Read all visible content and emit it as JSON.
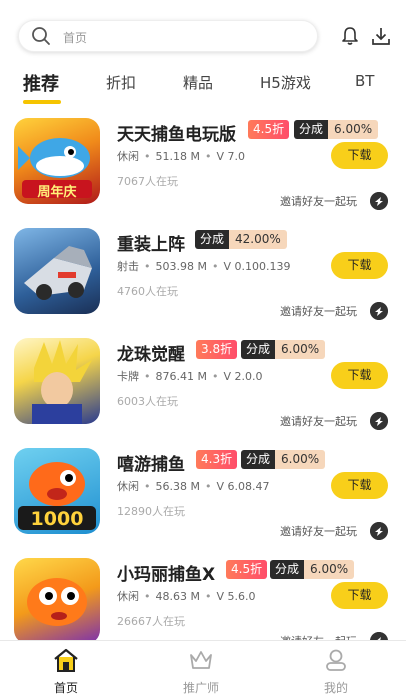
{
  "search": {
    "placeholder": "首页",
    "icon": "search-icon"
  },
  "header_icons": [
    "bell-icon",
    "download-icon"
  ],
  "tabs": [
    {
      "label": "推荐",
      "active": true
    },
    {
      "label": "折扣"
    },
    {
      "label": "精品"
    },
    {
      "label": "H5游戏"
    },
    {
      "label": "BT"
    }
  ],
  "games": [
    {
      "name": "天天捕鱼电玩版",
      "discount": "4.5折",
      "share_label": "分成",
      "share_value": "6.00%",
      "category": "休闲",
      "size": "51.18 M",
      "version": "V 7.0",
      "players": "7067人在玩",
      "download_label": "下载",
      "invite_label": "邀请好友一起玩",
      "thumb_caption": "周年庆"
    },
    {
      "name": "重装上阵",
      "discount": "",
      "share_label": "分成",
      "share_value": "42.00%",
      "category": "射击",
      "size": "503.98 M",
      "version": "V 0.100.139",
      "players": "4760人在玩",
      "download_label": "下载",
      "invite_label": "邀请好友一起玩",
      "thumb_caption": ""
    },
    {
      "name": "龙珠觉醒",
      "discount": "3.8折",
      "share_label": "分成",
      "share_value": "6.00%",
      "category": "卡牌",
      "size": "876.41 M",
      "version": "V 2.0.0",
      "players": "6003人在玩",
      "download_label": "下载",
      "invite_label": "邀请好友一起玩",
      "thumb_caption": ""
    },
    {
      "name": "嘻游捕鱼",
      "discount": "4.3折",
      "share_label": "分成",
      "share_value": "6.00%",
      "category": "休闲",
      "size": "56.38 M",
      "version": "V 6.08.47",
      "players": "12890人在玩",
      "download_label": "下载",
      "invite_label": "邀请好友一起玩",
      "thumb_caption": "1000"
    },
    {
      "name": "小玛丽捕鱼X",
      "discount": "4.5折",
      "share_label": "分成",
      "share_value": "6.00%",
      "category": "休闲",
      "size": "48.63 M",
      "version": "V 5.6.0",
      "players": "26667人在玩",
      "download_label": "下载",
      "invite_label": "邀请好友一起玩",
      "thumb_caption": ""
    }
  ],
  "bottom_nav": [
    {
      "label": "首页",
      "icon": "home-icon",
      "active": true
    },
    {
      "label": "推广师",
      "icon": "crown-icon"
    },
    {
      "label": "我的",
      "icon": "user-icon"
    }
  ],
  "colors": {
    "accent": "#f8cf1a",
    "discount": "#ff5a68",
    "share_dark": "#2a2a2a",
    "share_light": "#f6d7bb"
  }
}
